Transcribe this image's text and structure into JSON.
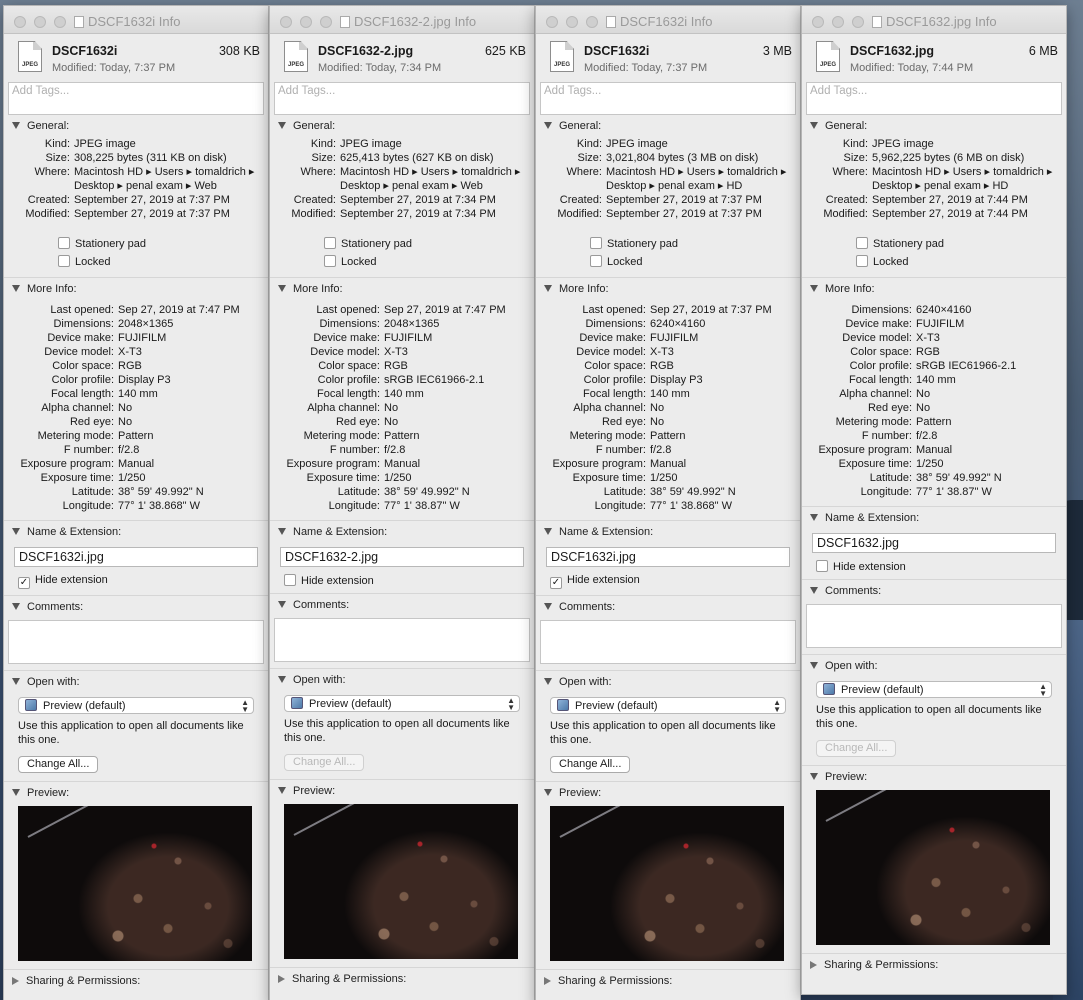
{
  "windows": [
    {
      "title": "DSCF1632i Info",
      "name": "DSCF1632i",
      "size": "308 KB",
      "modified_short": "Modified: Today, 7:37 PM",
      "icon_label": "JPEG",
      "tags_placeholder": "Add Tags...",
      "general": {
        "label": "General:",
        "rows": [
          {
            "k": "Kind:",
            "v": "JPEG image"
          },
          {
            "k": "Size:",
            "v": "308,225 bytes (311 KB on disk)"
          },
          {
            "k": "Where:",
            "v": "Macintosh HD ▸ Users ▸ tomaldrich ▸ Desktop ▸ penal exam ▸ Web"
          },
          {
            "k": "Created:",
            "v": "September 27, 2019 at 7:37 PM"
          },
          {
            "k": "Modified:",
            "v": "September 27, 2019 at 7:37 PM"
          }
        ],
        "stationery": "Stationery pad",
        "locked": "Locked"
      },
      "more_info": {
        "label": "More Info:",
        "rows": [
          {
            "k": "Last opened:",
            "v": "Sep 27, 2019 at 7:47 PM"
          },
          {
            "k": "Dimensions:",
            "v": "2048×1365"
          },
          {
            "k": "Device make:",
            "v": "FUJIFILM"
          },
          {
            "k": "Device model:",
            "v": "X-T3"
          },
          {
            "k": "Color space:",
            "v": "RGB"
          },
          {
            "k": "Color profile:",
            "v": "Display P3"
          },
          {
            "k": "Focal length:",
            "v": "140 mm"
          },
          {
            "k": "Alpha channel:",
            "v": "No"
          },
          {
            "k": "Red eye:",
            "v": "No"
          },
          {
            "k": "Metering mode:",
            "v": "Pattern"
          },
          {
            "k": "F number:",
            "v": "f/2.8"
          },
          {
            "k": "Exposure program:",
            "v": "Manual"
          },
          {
            "k": "Exposure time:",
            "v": "1/250"
          },
          {
            "k": "Latitude:",
            "v": "38° 59' 49.992\" N"
          },
          {
            "k": "Longitude:",
            "v": "77° 1' 38.868\" W"
          }
        ]
      },
      "name_ext": {
        "label": "Name & Extension:",
        "value": "DSCF1632i.jpg",
        "hide_label": "Hide extension",
        "hide_checked": true
      },
      "comments_label": "Comments:",
      "open_with": {
        "label": "Open with:",
        "app": "Preview (default)",
        "use_text": "Use this application to open all documents like this one.",
        "change_label": "Change All...",
        "change_enabled": true
      },
      "preview_label": "Preview:",
      "sharing_label": "Sharing & Permissions:"
    },
    {
      "title": "DSCF1632-2.jpg Info",
      "name": "DSCF1632-2.jpg",
      "size": "625 KB",
      "modified_short": "Modified: Today, 7:34 PM",
      "icon_label": "JPEG",
      "tags_placeholder": "Add Tags...",
      "general": {
        "label": "General:",
        "rows": [
          {
            "k": "Kind:",
            "v": "JPEG image"
          },
          {
            "k": "Size:",
            "v": "625,413 bytes (627 KB on disk)"
          },
          {
            "k": "Where:",
            "v": "Macintosh HD ▸ Users ▸ tomaldrich ▸ Desktop ▸ penal exam ▸ Web"
          },
          {
            "k": "Created:",
            "v": "September 27, 2019 at 7:34 PM"
          },
          {
            "k": "Modified:",
            "v": "September 27, 2019 at 7:34 PM"
          }
        ],
        "stationery": "Stationery pad",
        "locked": "Locked"
      },
      "more_info": {
        "label": "More Info:",
        "rows": [
          {
            "k": "Last opened:",
            "v": "Sep 27, 2019 at 7:47 PM"
          },
          {
            "k": "Dimensions:",
            "v": "2048×1365"
          },
          {
            "k": "Device make:",
            "v": "FUJIFILM"
          },
          {
            "k": "Device model:",
            "v": "X-T3"
          },
          {
            "k": "Color space:",
            "v": "RGB"
          },
          {
            "k": "Color profile:",
            "v": "sRGB IEC61966-2.1"
          },
          {
            "k": "Focal length:",
            "v": "140 mm"
          },
          {
            "k": "Alpha channel:",
            "v": "No"
          },
          {
            "k": "Red eye:",
            "v": "No"
          },
          {
            "k": "Metering mode:",
            "v": "Pattern"
          },
          {
            "k": "F number:",
            "v": "f/2.8"
          },
          {
            "k": "Exposure program:",
            "v": "Manual"
          },
          {
            "k": "Exposure time:",
            "v": "1/250"
          },
          {
            "k": "Latitude:",
            "v": "38° 59' 49.992\" N"
          },
          {
            "k": "Longitude:",
            "v": "77° 1' 38.87\" W"
          }
        ]
      },
      "name_ext": {
        "label": "Name & Extension:",
        "value": "DSCF1632-2.jpg",
        "hide_label": "Hide extension",
        "hide_checked": false
      },
      "comments_label": "Comments:",
      "open_with": {
        "label": "Open with:",
        "app": "Preview (default)",
        "use_text": "Use this application to open all documents like this one.",
        "change_label": "Change All...",
        "change_enabled": false
      },
      "preview_label": "Preview:",
      "sharing_label": "Sharing & Permissions:"
    },
    {
      "title": "DSCF1632i Info",
      "name": "DSCF1632i",
      "size": "3 MB",
      "modified_short": "Modified: Today, 7:37 PM",
      "icon_label": "JPEG",
      "tags_placeholder": "Add Tags...",
      "general": {
        "label": "General:",
        "rows": [
          {
            "k": "Kind:",
            "v": "JPEG image"
          },
          {
            "k": "Size:",
            "v": "3,021,804 bytes (3 MB on disk)"
          },
          {
            "k": "Where:",
            "v": "Macintosh HD ▸ Users ▸ tomaldrich ▸ Desktop ▸ penal exam ▸ HD"
          },
          {
            "k": "Created:",
            "v": "September 27, 2019 at 7:37 PM"
          },
          {
            "k": "Modified:",
            "v": "September 27, 2019 at 7:37 PM"
          }
        ],
        "stationery": "Stationery pad",
        "locked": "Locked"
      },
      "more_info": {
        "label": "More Info:",
        "rows": [
          {
            "k": "Last opened:",
            "v": "Sep 27, 2019 at 7:37 PM"
          },
          {
            "k": "Dimensions:",
            "v": "6240×4160"
          },
          {
            "k": "Device make:",
            "v": "FUJIFILM"
          },
          {
            "k": "Device model:",
            "v": "X-T3"
          },
          {
            "k": "Color space:",
            "v": "RGB"
          },
          {
            "k": "Color profile:",
            "v": "Display P3"
          },
          {
            "k": "Focal length:",
            "v": "140 mm"
          },
          {
            "k": "Alpha channel:",
            "v": "No"
          },
          {
            "k": "Red eye:",
            "v": "No"
          },
          {
            "k": "Metering mode:",
            "v": "Pattern"
          },
          {
            "k": "F number:",
            "v": "f/2.8"
          },
          {
            "k": "Exposure program:",
            "v": "Manual"
          },
          {
            "k": "Exposure time:",
            "v": "1/250"
          },
          {
            "k": "Latitude:",
            "v": "38° 59' 49.992\" N"
          },
          {
            "k": "Longitude:",
            "v": "77° 1' 38.868\" W"
          }
        ]
      },
      "name_ext": {
        "label": "Name & Extension:",
        "value": "DSCF1632i.jpg",
        "hide_label": "Hide extension",
        "hide_checked": true
      },
      "comments_label": "Comments:",
      "open_with": {
        "label": "Open with:",
        "app": "Preview (default)",
        "use_text": "Use this application to open all documents like this one.",
        "change_label": "Change All...",
        "change_enabled": true
      },
      "preview_label": "Preview:",
      "sharing_label": "Sharing & Permissions:"
    },
    {
      "title": "DSCF1632.jpg Info",
      "name": "DSCF1632.jpg",
      "size": "6 MB",
      "modified_short": "Modified: Today, 7:44 PM",
      "icon_label": "JPEG",
      "tags_placeholder": "Add Tags...",
      "general": {
        "label": "General:",
        "rows": [
          {
            "k": "Kind:",
            "v": "JPEG image"
          },
          {
            "k": "Size:",
            "v": "5,962,225 bytes (6 MB on disk)"
          },
          {
            "k": "Where:",
            "v": "Macintosh HD ▸ Users ▸ tomaldrich ▸ Desktop ▸ penal exam ▸ HD"
          },
          {
            "k": "Created:",
            "v": "September 27, 2019 at 7:44 PM"
          },
          {
            "k": "Modified:",
            "v": "September 27, 2019 at 7:44 PM"
          }
        ],
        "stationery": "Stationery pad",
        "locked": "Locked"
      },
      "more_info": {
        "label": "More Info:",
        "rows": [
          {
            "k": "Dimensions:",
            "v": "6240×4160"
          },
          {
            "k": "Device make:",
            "v": "FUJIFILM"
          },
          {
            "k": "Device model:",
            "v": "X-T3"
          },
          {
            "k": "Color space:",
            "v": "RGB"
          },
          {
            "k": "Color profile:",
            "v": "sRGB IEC61966-2.1"
          },
          {
            "k": "Focal length:",
            "v": "140 mm"
          },
          {
            "k": "Alpha channel:",
            "v": "No"
          },
          {
            "k": "Red eye:",
            "v": "No"
          },
          {
            "k": "Metering mode:",
            "v": "Pattern"
          },
          {
            "k": "F number:",
            "v": "f/2.8"
          },
          {
            "k": "Exposure program:",
            "v": "Manual"
          },
          {
            "k": "Exposure time:",
            "v": "1/250"
          },
          {
            "k": "Latitude:",
            "v": "38° 59' 49.992\" N"
          },
          {
            "k": "Longitude:",
            "v": "77° 1' 38.87\" W"
          }
        ]
      },
      "name_ext": {
        "label": "Name & Extension:",
        "value": "DSCF1632.jpg",
        "hide_label": "Hide extension",
        "hide_checked": false
      },
      "comments_label": "Comments:",
      "open_with": {
        "label": "Open with:",
        "app": "Preview (default)",
        "use_text": "Use this application to open all documents like this one.",
        "change_label": "Change All...",
        "change_enabled": false
      },
      "preview_label": "Preview:",
      "sharing_label": "Sharing & Permissions:"
    }
  ]
}
